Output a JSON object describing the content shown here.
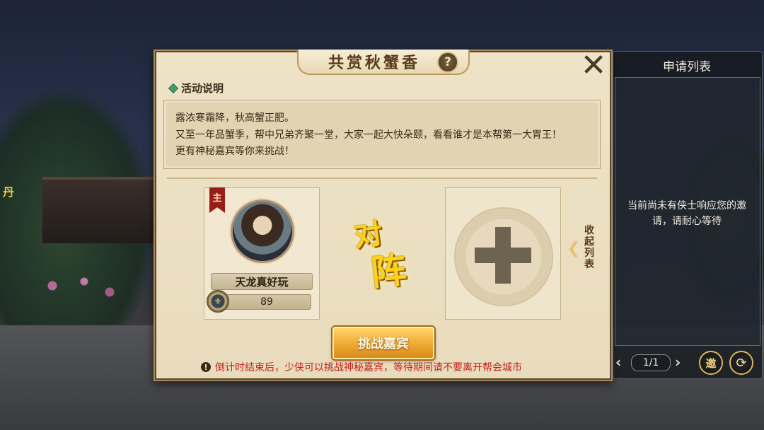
{
  "dialog": {
    "title": "共赏秋蟹香",
    "help_glyph": "?",
    "close_glyph": "✕",
    "section_title": "活动说明",
    "description": [
      "露浓寒霜降，秋高蟹正肥。",
      "又至一年品蟹季，帮中兄弟齐聚一堂，大家一起大快朵颐，看看谁才是本帮第一大胃王！",
      "更有神秘嘉宾等你来挑战！"
    ]
  },
  "player": {
    "rank_badge": "主",
    "name": "天龙真好玩",
    "power": "89"
  },
  "versus": {
    "char1": "对",
    "char2": "阵"
  },
  "collapse_label": "收起列表",
  "challenge_button": "挑战嘉宾",
  "notice": "倒计时结束后，少侠可以挑战神秘嘉宾，等待期间请不要离开帮会城市",
  "notice_icon": "!",
  "side_panel": {
    "title": "申请列表",
    "empty_text": "当前尚未有侠士响应您的邀请，请耐心等待",
    "page": "1/1",
    "prev_glyph": "‹",
    "next_glyph": "›",
    "invite_label": "邀",
    "refresh_glyph": "⟳"
  },
  "background": {
    "label": "丹"
  }
}
